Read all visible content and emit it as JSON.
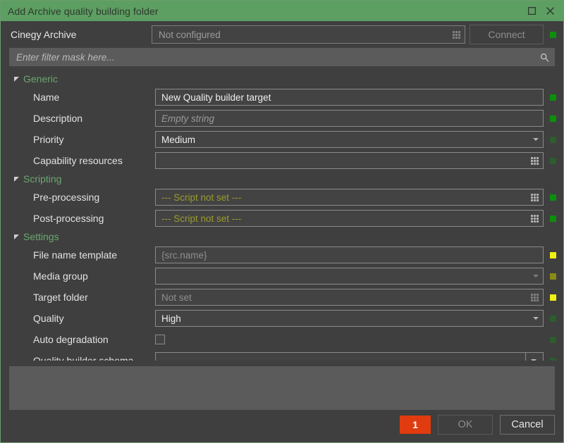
{
  "window": {
    "title": "Add Archive quality building folder",
    "maximize_icon": "maximize-icon",
    "close_icon": "close-icon",
    "accent_color": "#5d9e62"
  },
  "archive": {
    "label": "Cinegy Archive",
    "value": "Not configured",
    "browse_icon": "grid-dots-icon",
    "connect_label": "Connect",
    "indicator_color": "#0c8f0c"
  },
  "filter": {
    "placeholder": "Enter filter mask here...",
    "search_icon": "search-icon"
  },
  "sections": [
    {
      "label": "Generic",
      "rows": [
        {
          "label": "Name",
          "value": "New Quality builder target",
          "style": "text",
          "adornment": "none",
          "indicator": "#0c8f0c"
        },
        {
          "label": "Description",
          "value": "Empty string",
          "style": "placeholder",
          "adornment": "none",
          "indicator": "#0c8f0c"
        },
        {
          "label": "Priority",
          "value": "Medium",
          "style": "text",
          "adornment": "chevron",
          "indicator": "#2d5c2d"
        },
        {
          "label": "Capability resources",
          "value": "",
          "style": "text",
          "adornment": "dots",
          "indicator": "#2d5c2d"
        }
      ]
    },
    {
      "label": "Scripting",
      "rows": [
        {
          "label": "Pre-processing",
          "value": "--- Script not set ---",
          "style": "script",
          "adornment": "dots",
          "indicator": "#0c8f0c"
        },
        {
          "label": "Post-processing",
          "value": "--- Script not set ---",
          "style": "script",
          "adornment": "dots",
          "indicator": "#0c8f0c"
        }
      ]
    },
    {
      "label": "Settings",
      "rows": [
        {
          "label": "File name template",
          "value": "{src.name}",
          "style": "dim",
          "adornment": "none",
          "indicator": "#f0f013"
        },
        {
          "label": "Media group",
          "value": "",
          "style": "text",
          "adornment": "chevrondim",
          "indicator": "#8a8a16"
        },
        {
          "label": "Target folder",
          "value": "Not set",
          "style": "dim",
          "adornment": "dotsdim",
          "indicator": "#f0f013"
        },
        {
          "label": "Quality",
          "value": "High",
          "style": "text",
          "adornment": "chevron",
          "indicator": "#2d5c2d"
        },
        {
          "label": "Auto degradation",
          "value": "",
          "style": "check",
          "adornment": "none",
          "indicator": "#2d5c2d"
        },
        {
          "label": "Quality builder schema",
          "value": "",
          "style": "text",
          "adornment": "combosplit",
          "indicator": "#2d5c2d"
        }
      ]
    }
  ],
  "footer": {
    "error_count": "1",
    "error_color": "#e03c10",
    "ok_label": "OK",
    "cancel_label": "Cancel"
  }
}
